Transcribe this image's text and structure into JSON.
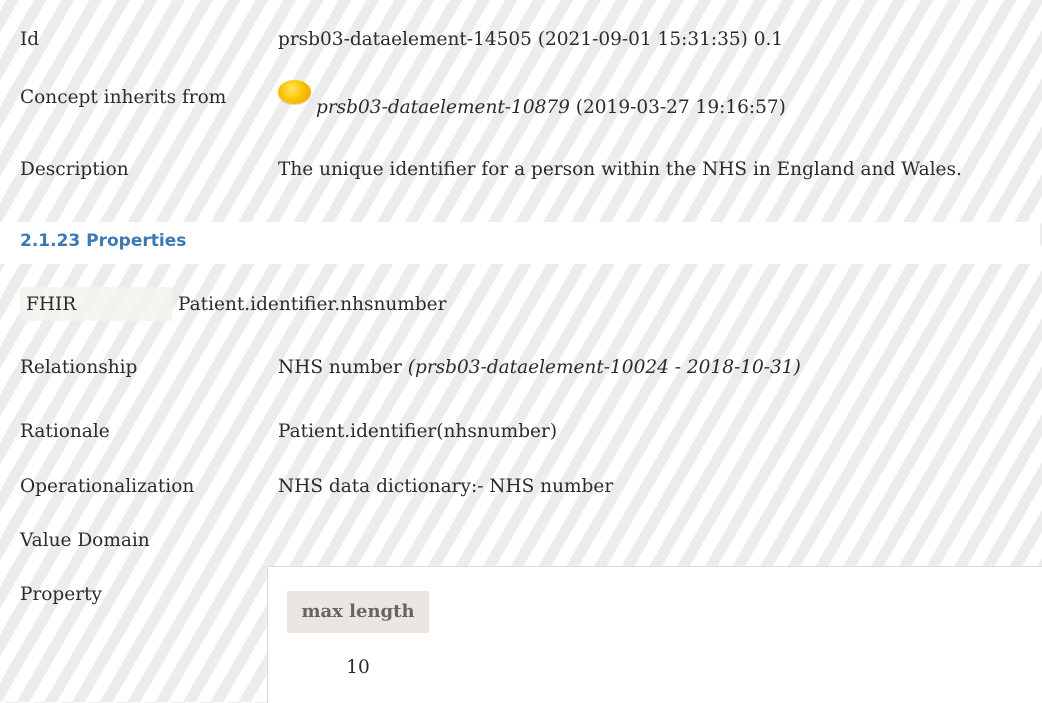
{
  "id_row": {
    "label": "Id",
    "value": "prsb03-dataelement-14505 (2021-09-01 15:31:35) 0.1"
  },
  "inherits_row": {
    "label": "Concept inherits from",
    "icon": "yellow-orb-icon",
    "link": "prsb03-dataelement-10879",
    "date": " (2019-03-27 19:16:57)"
  },
  "description_row": {
    "label": "Description",
    "value": "The unique identifier for a person within the NHS in England and Wales."
  },
  "section": {
    "title": "2.1.23 Properties"
  },
  "fhir_row": {
    "label": "FHIR",
    "value": "Patient.identifier.nhsnumber"
  },
  "relationship_row": {
    "label": "Relationship",
    "value": "NHS number ",
    "ref": "(prsb03-dataelement-10024 - 2018-10-31)"
  },
  "rationale_row": {
    "label": "Rationale",
    "value": "Patient.identifier(nhsnumber)"
  },
  "operationalization_row": {
    "label": "Operationalization",
    "value": "NHS data dictionary:- NHS number"
  },
  "value_domain_row": {
    "label": "Value Domain"
  },
  "property_row": {
    "label": "Property",
    "header": "max length",
    "value": "10"
  },
  "colors": {
    "section_title": "#3b79b6",
    "stripe": "#ececec",
    "property_header_bg": "#ebe6e1"
  }
}
